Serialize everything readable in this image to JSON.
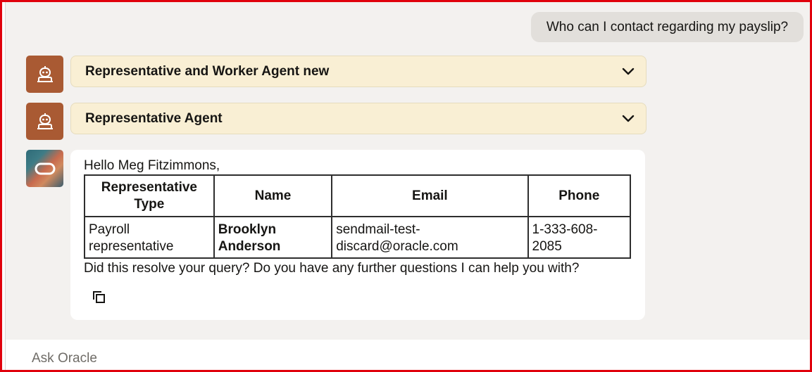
{
  "user_message": "Who can I contact regarding my payslip?",
  "agents": [
    {
      "title": "Representative and Worker Agent new",
      "icon": "robot-icon"
    },
    {
      "title": "Representative Agent",
      "icon": "robot-icon"
    }
  ],
  "response": {
    "greeting": "Hello Meg Fitzimmons,",
    "table": {
      "headers": {
        "type": "Representative Type",
        "name": "Name",
        "email": "Email",
        "phone": "Phone"
      },
      "rows": [
        {
          "type": "Payroll representative",
          "name": "Brooklyn Anderson",
          "email": "sendmail-test-discard@oracle.com",
          "phone": "1-333-608-2085"
        }
      ]
    },
    "followup": "Did this resolve your query? Do you have any further questions I can help you with?",
    "copy_icon": "copy-icon"
  },
  "input": {
    "placeholder": "Ask Oracle"
  },
  "colors": {
    "agent_avatar": "#a95a33",
    "accordion_bg": "#f9efd4",
    "chat_bg": "#f3f1ef",
    "user_bubble": "#e2dfdb",
    "frame_border": "#e0000c"
  }
}
